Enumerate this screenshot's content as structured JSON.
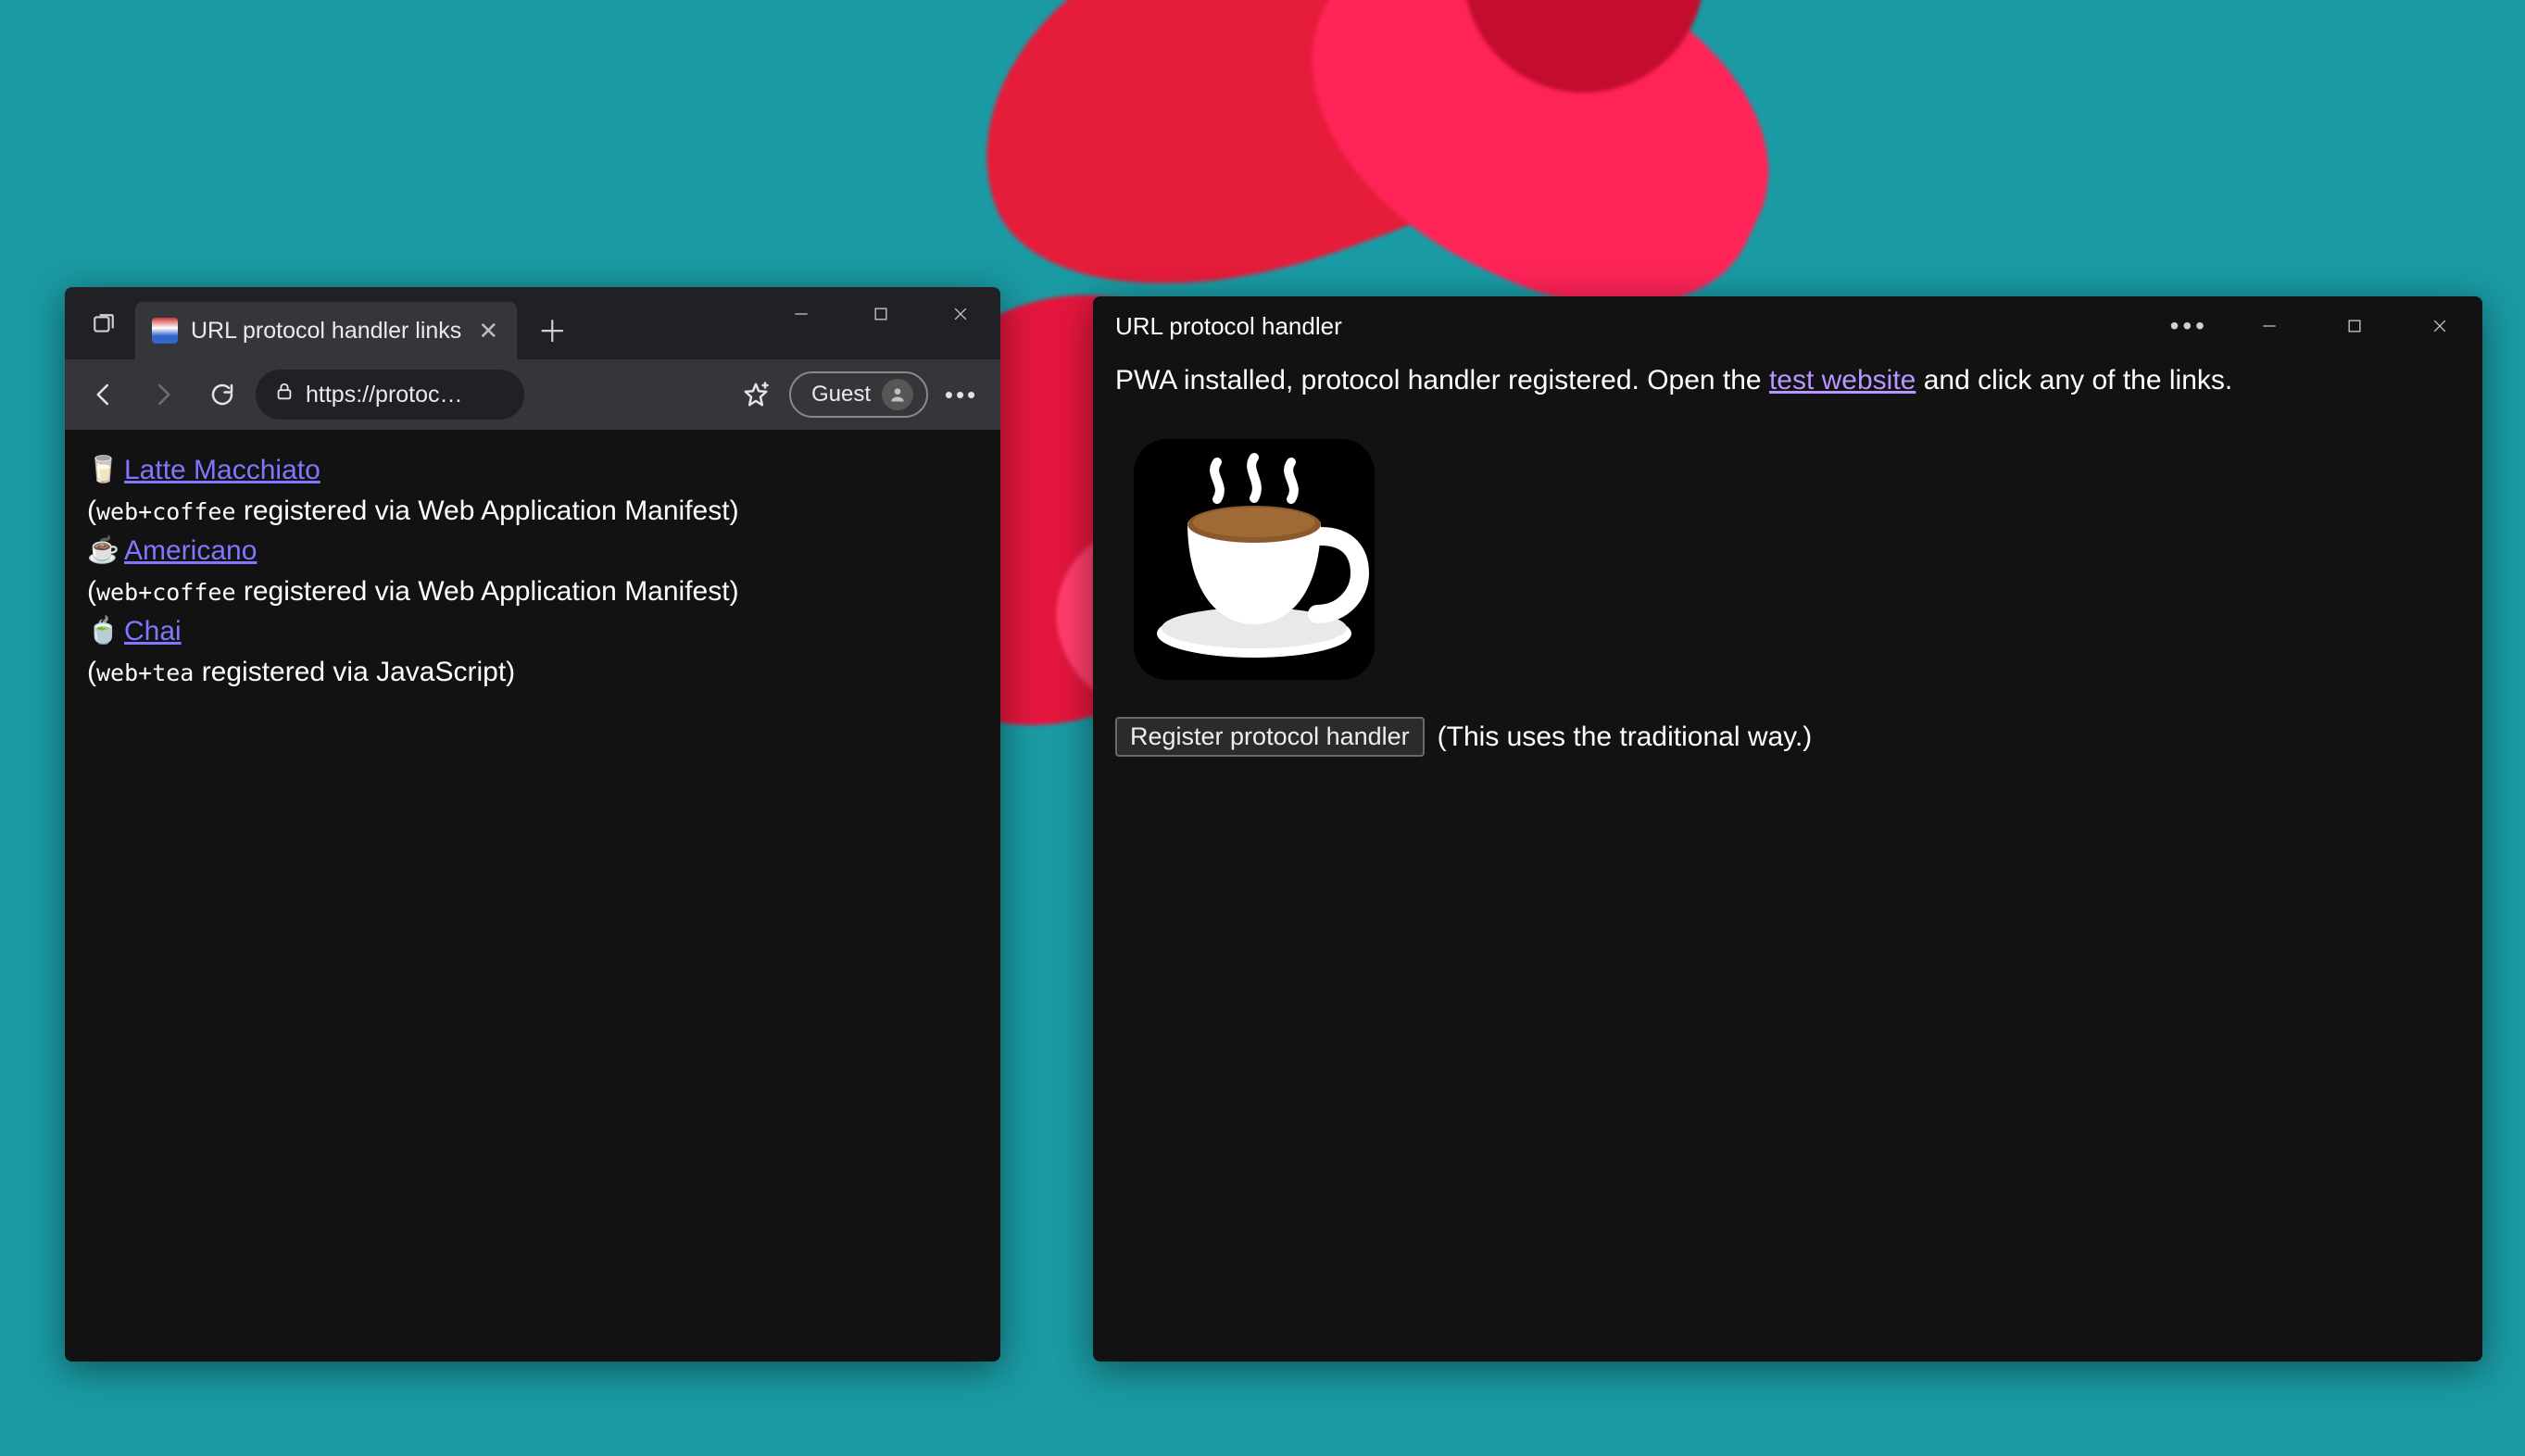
{
  "browser": {
    "tab_title": "URL protocol handler links",
    "address": "https://protoc…",
    "guest_label": "Guest",
    "links": [
      {
        "emoji": "🥛",
        "text": " Latte Macchiato",
        "note_prefix": "(",
        "code": "web+coffee",
        "note_suffix": " registered via Web Application Manifest)"
      },
      {
        "emoji": "☕",
        "text": " Americano",
        "note_prefix": "(",
        "code": "web+coffee",
        "note_suffix": " registered via Web Application Manifest)"
      },
      {
        "emoji": "🍵",
        "text": " Chai",
        "note_prefix": "(",
        "code": "web+tea",
        "note_suffix": " registered via JavaScript)"
      }
    ]
  },
  "pwa": {
    "title": "URL protocol handler",
    "body_prefix": "PWA installed, protocol handler registered. Open the ",
    "body_link": "test website",
    "body_suffix": " and click any of the links.",
    "register_button": "Register protocol handler",
    "register_note": "(This uses the traditional way.)"
  }
}
